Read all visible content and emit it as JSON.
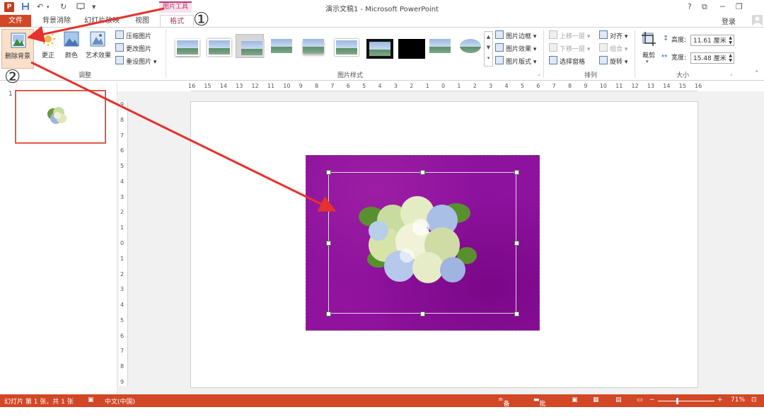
{
  "app": {
    "icon_letter": "P",
    "window_title": "演示文稿1 - Microsoft PowerPoint",
    "qat": {
      "save_icon": "save-icon",
      "undo_icon": "undo-icon",
      "redo_icon": "redo-icon",
      "customize": "▼"
    },
    "window_controls": {
      "help": "?",
      "ribbon_options": "⧉",
      "minimize": "─",
      "restore": "❐"
    },
    "login": "登录"
  },
  "contextual_tab_group": "图片工具",
  "tabs": [
    "文件",
    "背景消除",
    "幻灯片放映",
    "视图",
    "格式"
  ],
  "ribbon": {
    "adjust": {
      "remove_bg": "删除背景",
      "corrections": "更正",
      "color": "颜色",
      "artistic": "艺术效果",
      "compress": "压缩图片",
      "change": "更改图片",
      "reset": "重设图片",
      "group_label": "调整"
    },
    "styles": {
      "group_label": "图片样式",
      "border": "图片边框",
      "effects": "图片效果",
      "layout": "图片版式"
    },
    "arrange": {
      "group_label": "排列",
      "bring_forward": "上移一层",
      "send_backward": "下移一层",
      "selection_pane": "选择窗格",
      "align": "对齐",
      "group": "组合",
      "rotate": "旋转"
    },
    "size": {
      "group_label": "大小",
      "crop": "裁剪",
      "height_label": "高度:",
      "height_value": "11.61 厘米",
      "width_label": "宽度:",
      "width_value": "15.48 厘米"
    }
  },
  "ruler": {
    "h_ticks": [
      "16",
      "15",
      "14",
      "13",
      "12",
      "11",
      "10",
      "9",
      "8",
      "7",
      "6",
      "5",
      "4",
      "3",
      "2",
      "1",
      "0",
      "1",
      "2",
      "3",
      "4",
      "5",
      "6",
      "7",
      "8",
      "9",
      "10",
      "11",
      "12",
      "13",
      "14",
      "15",
      "16"
    ],
    "v_ticks": [
      "9",
      "8",
      "7",
      "6",
      "5",
      "4",
      "3",
      "2",
      "1",
      "0",
      "1",
      "2",
      "3",
      "4",
      "5",
      "6",
      "7",
      "8",
      "9"
    ]
  },
  "thumbnails": {
    "slide_number": "1"
  },
  "annotations": {
    "step1": "①",
    "step2": "②"
  },
  "status": {
    "slide_info": "幻灯片 第 1 张，共 1 张",
    "language": "中文(中国)",
    "notes": "备注",
    "comments": "批注",
    "zoom": "71%",
    "zoom_minus": "−",
    "zoom_plus": "+",
    "zoom_level": 0.71
  },
  "colors": {
    "accent": "#d24726",
    "contextual": "#c13a6e",
    "picture_bg": "#8d129d",
    "arrow": "#e5322d"
  }
}
